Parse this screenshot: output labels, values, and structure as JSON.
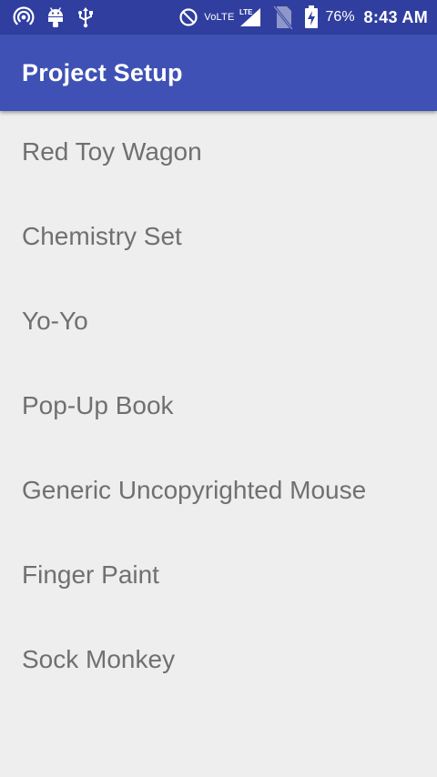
{
  "status_bar": {
    "icons_left": [
      "hotspot-icon",
      "android-icon",
      "usb-icon"
    ],
    "icons_right": [
      "do-not-disturb-icon",
      "signal-icon",
      "no-sim-icon",
      "battery-charging-icon"
    ],
    "volte_label": "VoLTE",
    "lte_label": "LTE",
    "battery_percent": "76%",
    "time": "8:43 AM",
    "background_color": "#303f9f"
  },
  "app_bar": {
    "title": "Project Setup",
    "background_color": "#3f51b5"
  },
  "list": {
    "items": [
      {
        "label": "Red Toy Wagon"
      },
      {
        "label": "Chemistry Set"
      },
      {
        "label": "Yo-Yo"
      },
      {
        "label": "Pop-Up Book"
      },
      {
        "label": "Generic Uncopyrighted Mouse"
      },
      {
        "label": "Finger Paint"
      },
      {
        "label": "Sock Monkey"
      }
    ]
  },
  "colors": {
    "background": "#eeeeee",
    "item_text": "#707070"
  }
}
